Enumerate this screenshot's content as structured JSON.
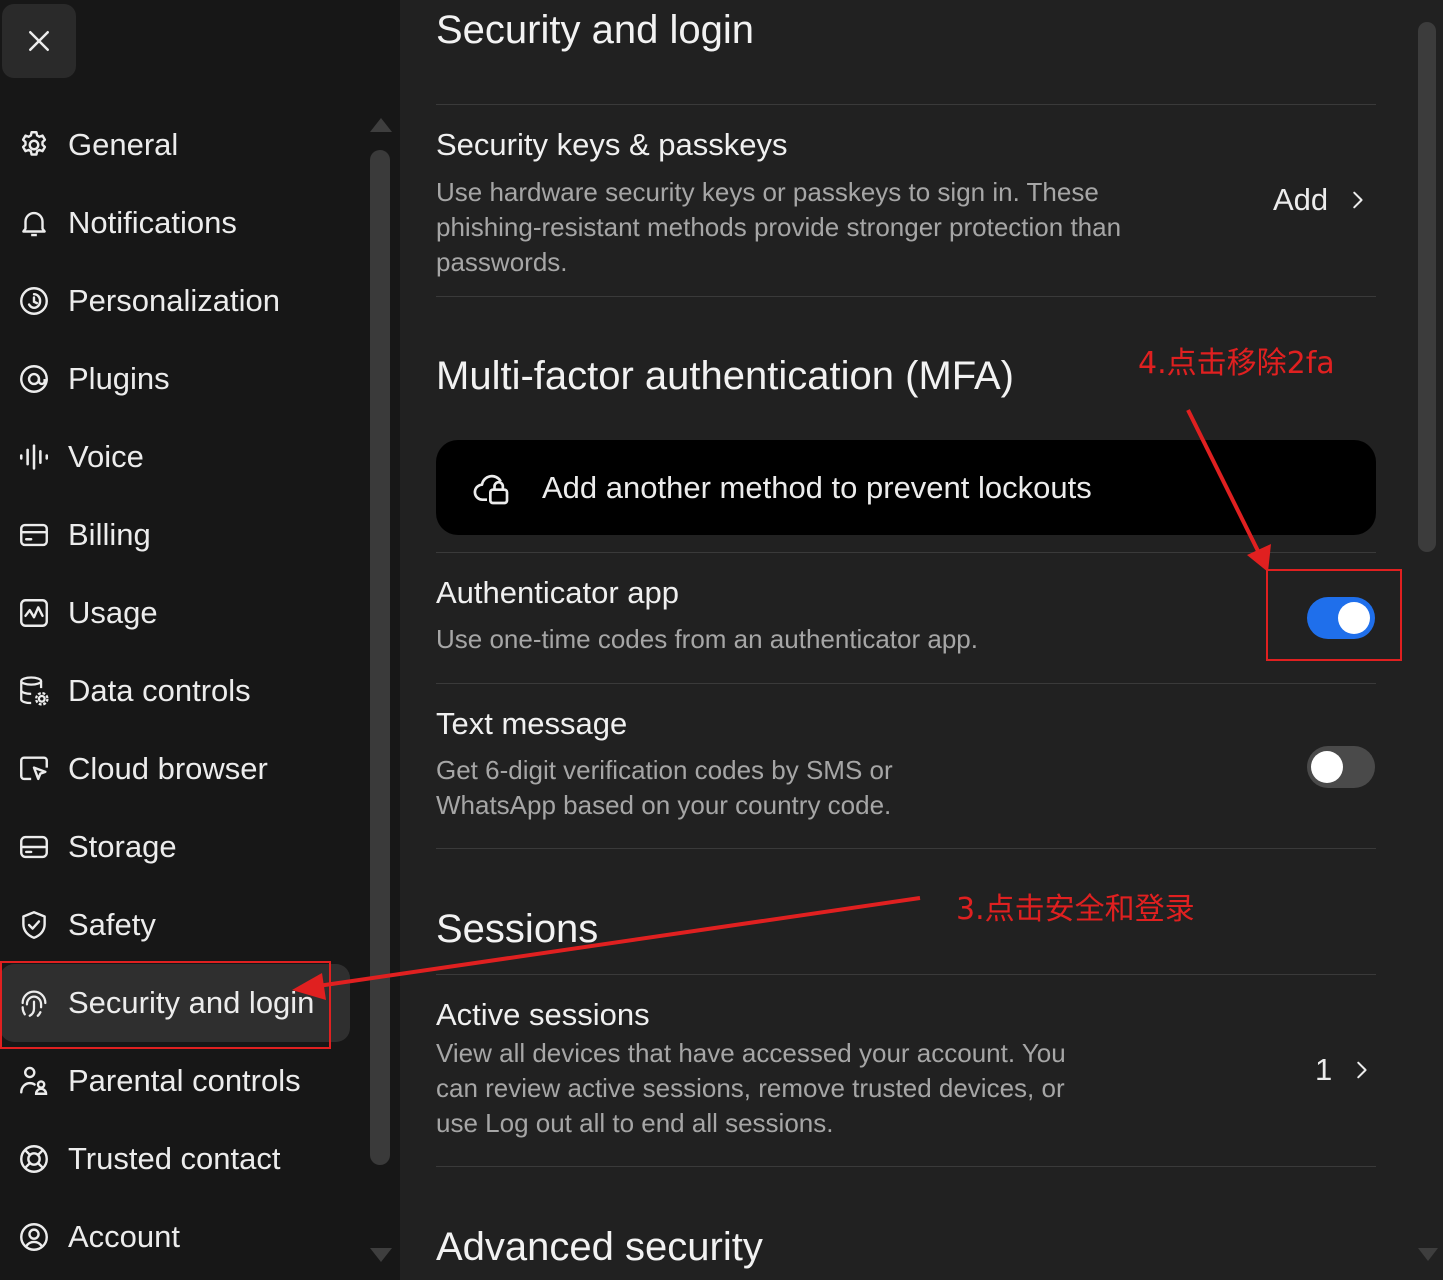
{
  "sidebar": {
    "close_icon": "close-icon",
    "items": [
      {
        "label": "General",
        "icon": "gear-icon"
      },
      {
        "label": "Notifications",
        "icon": "bell-icon"
      },
      {
        "label": "Personalization",
        "icon": "personalization-icon"
      },
      {
        "label": "Plugins",
        "icon": "plugins-icon"
      },
      {
        "label": "Voice",
        "icon": "voice-waveform-icon"
      },
      {
        "label": "Billing",
        "icon": "credit-card-icon"
      },
      {
        "label": "Usage",
        "icon": "usage-chart-icon"
      },
      {
        "label": "Data controls",
        "icon": "database-gear-icon"
      },
      {
        "label": "Cloud browser",
        "icon": "cloud-browser-icon"
      },
      {
        "label": "Storage",
        "icon": "storage-drive-icon"
      },
      {
        "label": "Safety",
        "icon": "shield-check-icon"
      },
      {
        "label": "Security and login",
        "icon": "security-login-icon",
        "active": true
      },
      {
        "label": "Parental controls",
        "icon": "parental-controls-icon"
      },
      {
        "label": "Trusted contact",
        "icon": "lifebuoy-icon"
      },
      {
        "label": "Account",
        "icon": "account-icon"
      }
    ]
  },
  "main": {
    "title": "Security and login",
    "passkeys": {
      "title": "Security keys & passkeys",
      "description": "Use hardware security keys or passkeys to sign in. These phishing-resistant methods provide stronger protection than passwords.",
      "action": "Add"
    },
    "mfa": {
      "title": "Multi-factor authentication (MFA)",
      "banner": "Add another method to prevent lockouts",
      "authenticator": {
        "title": "Authenticator app",
        "description": "Use one-time codes from an authenticator app.",
        "enabled": true
      },
      "sms": {
        "title": "Text message",
        "description": "Get 6-digit verification codes by SMS or WhatsApp based on your country code.",
        "enabled": false
      }
    },
    "sessions": {
      "title": "Sessions",
      "active": {
        "title": "Active sessions",
        "description": "View all devices that have accessed your account. You can review active sessions, remove trusted devices, or use Log out all to end all sessions.",
        "count": "1"
      }
    },
    "advanced": {
      "title": "Advanced security"
    }
  },
  "annotations": {
    "step3": "3.点击安全和登录",
    "step4": "4.点击移除2fa",
    "color": "#e02020"
  },
  "colors": {
    "accent": "#1f6feb",
    "sidebar_bg": "#171717",
    "main_bg": "#212121"
  }
}
